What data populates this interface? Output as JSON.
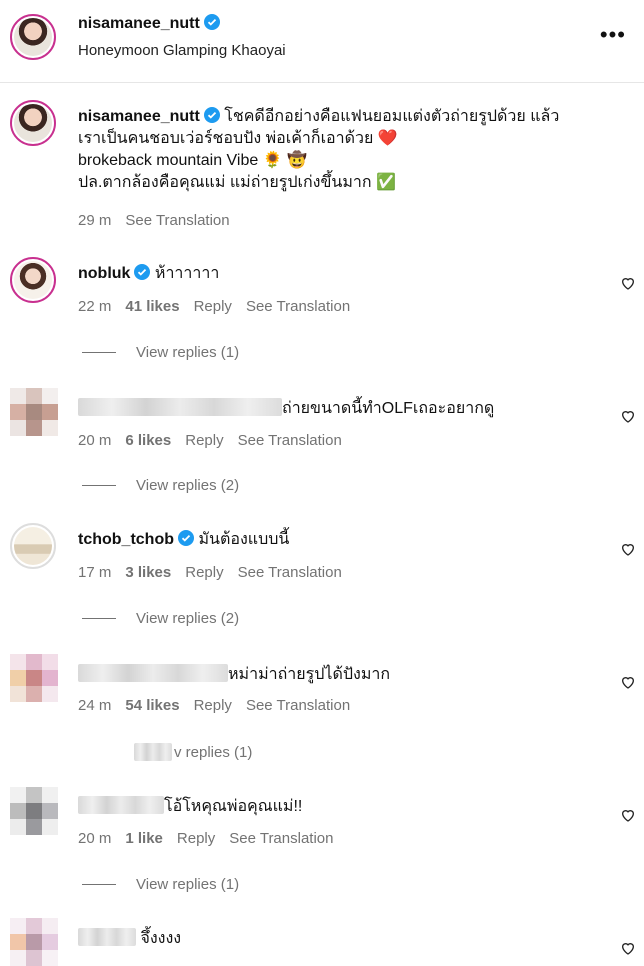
{
  "header": {
    "username": "nisamanee_nutt",
    "subtitle": "Honeymoon Glamping Khaoyai",
    "more_icon": "more-horizontal-icon"
  },
  "caption": {
    "username": "nisamanee_nutt",
    "line1": "โชคดีอีกอย่างคือแฟนยอมแต่งตัวถ่ายรูปด้วย แล้ว",
    "line2": "เราเป็นคนชอบเว่อร์ชอบปัง พ่อเค้าก็เอาด้วย ❤️",
    "line3": "brokeback mountain Vibe 🌻 🤠",
    "line4": "ปล.ตากล้องคือคุณแม่ แม่ถ่ายรูปเก่งขึ้นมาก ✅",
    "time": "29 m",
    "see_translation": "See Translation"
  },
  "comments": [
    {
      "username": "nobluk",
      "text": "ห้าาาาาา",
      "time": "22 m",
      "likes": "41 likes",
      "reply": "Reply",
      "see_translation": "See Translation",
      "view_replies": "View replies (1)"
    },
    {
      "username": "",
      "text": "ถ่ายขนาดนี้ทำOLFเถอะอยากดู",
      "time": "20 m",
      "likes": "6 likes",
      "reply": "Reply",
      "see_translation": "See Translation",
      "view_replies": "View replies (2)"
    },
    {
      "username": "tchob_tchob",
      "text": "มันต้องแบบนี้",
      "time": "17 m",
      "likes": "3 likes",
      "reply": "Reply",
      "see_translation": "See Translation",
      "view_replies": "View replies (2)"
    },
    {
      "username": "",
      "text": "หม่าม่าถ่ายรูปได้ปังมาก",
      "time": "24 m",
      "likes": "54 likes",
      "reply": "Reply",
      "see_translation": "See Translation",
      "view_replies": "v replies (1)"
    },
    {
      "username": "",
      "text": "โอ้โหคุณพ่อคุณแม่!!",
      "time": "20 m",
      "likes": "1 like",
      "reply": "Reply",
      "see_translation": "See Translation",
      "view_replies": "View replies (1)"
    },
    {
      "username": "",
      "text": "จึ้งงงง"
    }
  ],
  "icons": {
    "verified": "verified-badge-icon",
    "heart": "heart-outline-icon"
  },
  "colors": {
    "verified": "#1d9bf0",
    "story_ring": "#c8308f",
    "meta": "#737373"
  }
}
